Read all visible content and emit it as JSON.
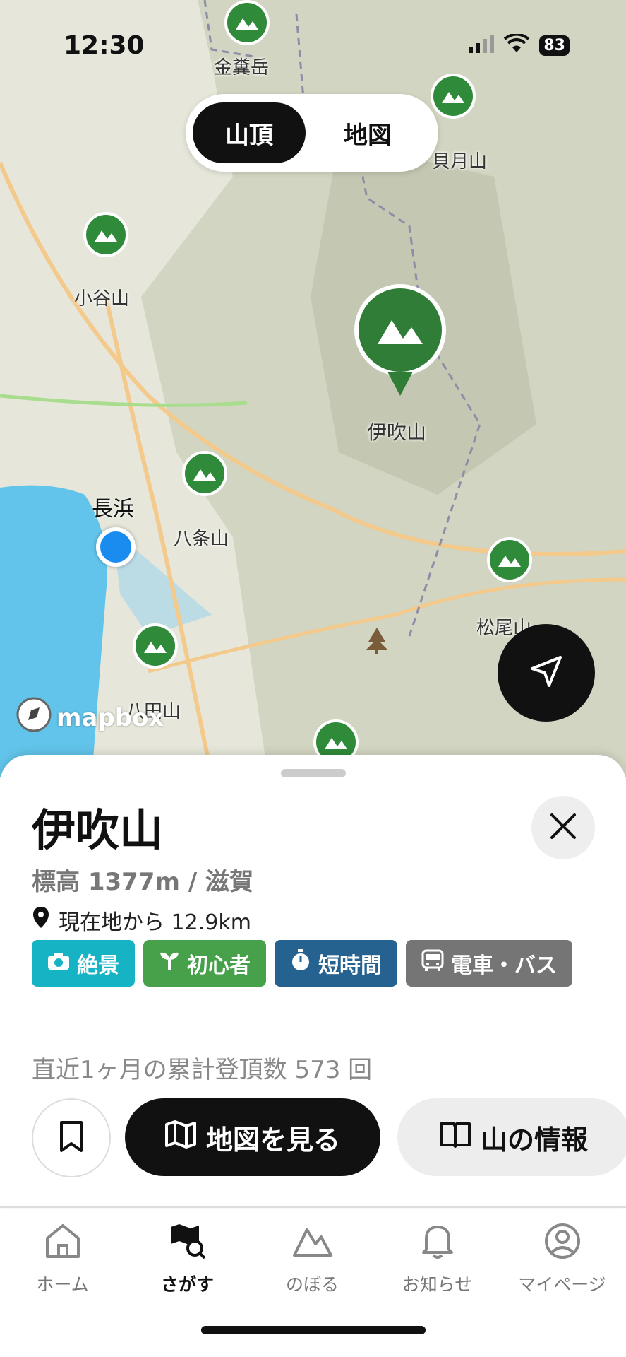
{
  "status_bar": {
    "time": "12:30",
    "battery": "83"
  },
  "segment": {
    "peak_label": "山頂",
    "map_label": "地図"
  },
  "map": {
    "peaks": [
      {
        "name": "金糞岳"
      },
      {
        "name": "貝月山"
      },
      {
        "name": "小谷山"
      },
      {
        "name": "伊吹山"
      },
      {
        "name": "八条山"
      },
      {
        "name": "松尾山"
      },
      {
        "name": "八田山"
      }
    ],
    "city": "長浜",
    "attribution": "mapbox"
  },
  "detail": {
    "title": "伊吹山",
    "subtitle": "標高 1377m / 滋賀",
    "distance": "現在地から 12.9km",
    "tags": [
      {
        "label": "絶景",
        "color": "#16b3c4",
        "icon": "camera-icon"
      },
      {
        "label": "初心者",
        "color": "#46a14a",
        "icon": "sprout-icon"
      },
      {
        "label": "短時間",
        "color": "#25628f",
        "icon": "timer-icon"
      },
      {
        "label": "電車・バス",
        "color": "#757575",
        "icon": "bus-icon"
      }
    ],
    "summit_count": "直近1ヶ月の累計登頂数 573 回",
    "view_map_label": "地図を見る",
    "mountain_info_label": "山の情報"
  },
  "tabs": [
    {
      "label": "ホーム",
      "icon": "home-icon",
      "active": false
    },
    {
      "label": "さがす",
      "icon": "map-search-icon",
      "active": true
    },
    {
      "label": "のぼる",
      "icon": "mountain-icon",
      "active": false
    },
    {
      "label": "お知らせ",
      "icon": "bell-icon",
      "active": false
    },
    {
      "label": "マイページ",
      "icon": "user-icon",
      "active": false
    }
  ]
}
